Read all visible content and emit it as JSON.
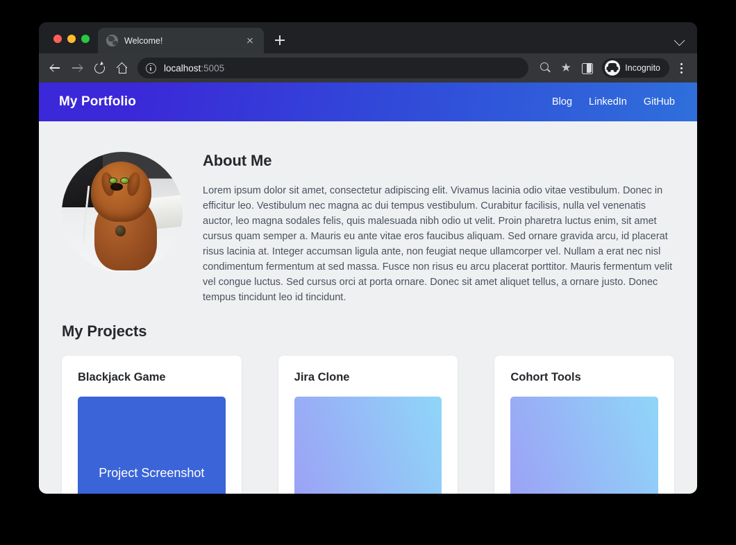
{
  "browser": {
    "traffic_lights": [
      "close",
      "minimize",
      "maximize"
    ],
    "tab": {
      "title": "Welcome!",
      "favicon": "globe-icon",
      "close_icon": "close-icon"
    },
    "new_tab_label": "+",
    "toolbar": {
      "back_icon": "arrow-left-icon",
      "forward_icon": "arrow-right-icon",
      "reload_icon": "reload-icon",
      "home_icon": "home-icon",
      "site_info_icon": "info-circle-icon",
      "url_host": "localhost",
      "url_port": ":5005",
      "search_icon": "search-icon",
      "bookmark_icon": "★",
      "side_panel_icon": "side-panel-icon",
      "incognito_label": "Incognito",
      "menu_icon": "three-dot-menu-icon"
    }
  },
  "site": {
    "brand": "My Portfolio",
    "nav_links": [
      {
        "label": "Blog"
      },
      {
        "label": "LinkedIn"
      },
      {
        "label": "GitHub"
      }
    ],
    "navbar_gradient_start": "#3b28d8",
    "navbar_gradient_end": "#2f6fdb",
    "page_background": "#eff0f2",
    "about": {
      "heading": "About Me",
      "avatar_alt": "photo-of-brown-poodle-wearing-green-sunglasses",
      "paragraph": "Lorem ipsum dolor sit amet, consectetur adipiscing elit. Vivamus lacinia odio vitae vestibulum. Donec in efficitur leo. Vestibulum nec magna ac dui tempus vestibulum. Curabitur facilisis, nulla vel venenatis auctor, leo magna sodales felis, quis malesuada nibh odio ut velit. Proin pharetra luctus enim, sit amet cursus quam semper a. Mauris eu ante vitae eros faucibus aliquam. Sed ornare gravida arcu, id placerat risus lacinia at. Integer accumsan ligula ante, non feugiat neque ullamcorper vel. Nullam a erat nec nisl condimentum fermentum at sed massa. Fusce non risus eu arcu placerat porttitor. Mauris fermentum velit vel congue luctus. Sed cursus orci at porta ornare. Donec sit amet aliquet tellus, a ornare justo. Donec tempus tincidunt leo id tincidunt."
    },
    "projects": {
      "heading": "My Projects",
      "cards": [
        {
          "title": "Blackjack Game",
          "thumb_label": "Project Screenshot",
          "thumb_style": "solid",
          "thumb_color": "#3a64d8"
        },
        {
          "title": "Jira Clone",
          "thumb_label": "",
          "thumb_style": "gradient",
          "thumb_color_start": "#9d9cf5",
          "thumb_color_end": "#8fd6f8"
        },
        {
          "title": "Cohort Tools",
          "thumb_label": "",
          "thumb_style": "gradient",
          "thumb_color_start": "#9d9cf5",
          "thumb_color_end": "#8fd6f8"
        }
      ]
    }
  }
}
